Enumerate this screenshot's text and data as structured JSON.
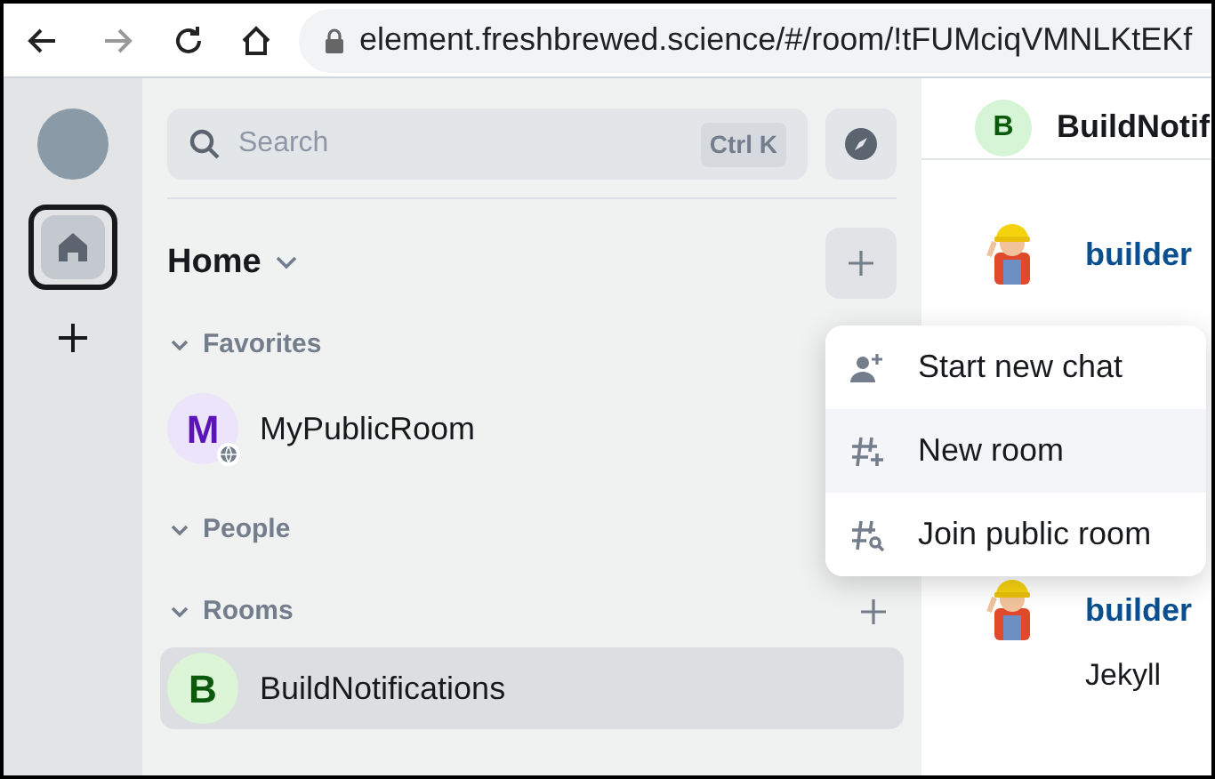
{
  "browser": {
    "url": "element.freshbrewed.science/#/room/!tFUMciqVMNLKtEKf"
  },
  "spaces": [
    {
      "kind": "home",
      "selected": true
    },
    {
      "kind": "create",
      "selected": false
    }
  ],
  "search": {
    "placeholder": "Search",
    "shortcut": "Ctrl K"
  },
  "home": {
    "title": "Home"
  },
  "sections": [
    {
      "title": "Favorites",
      "expanded": true,
      "add": false,
      "rooms": [
        {
          "letter": "M",
          "name": "MyPublicRoom",
          "color": "#5a14b8",
          "public": true,
          "selected": false
        }
      ]
    },
    {
      "title": "People",
      "expanded": true,
      "add": false
    },
    {
      "title": "Rooms",
      "expanded": true,
      "add": true,
      "rooms": [
        {
          "letter": "B",
          "name": "BuildNotifications",
          "color": "#0b5a0b",
          "public": false,
          "selected": true
        }
      ]
    }
  ],
  "menu": [
    {
      "kind": "chat",
      "label": "Start new chat",
      "selected": false
    },
    {
      "kind": "room",
      "label": "New room",
      "selected": true
    },
    {
      "kind": "join",
      "label": "Join public room",
      "selected": false
    }
  ],
  "room": {
    "letter": "B",
    "name": "BuildNotif"
  },
  "messages": [
    {
      "sender": "builder"
    },
    {
      "sender": "builder",
      "body": "Jekyll"
    }
  ]
}
